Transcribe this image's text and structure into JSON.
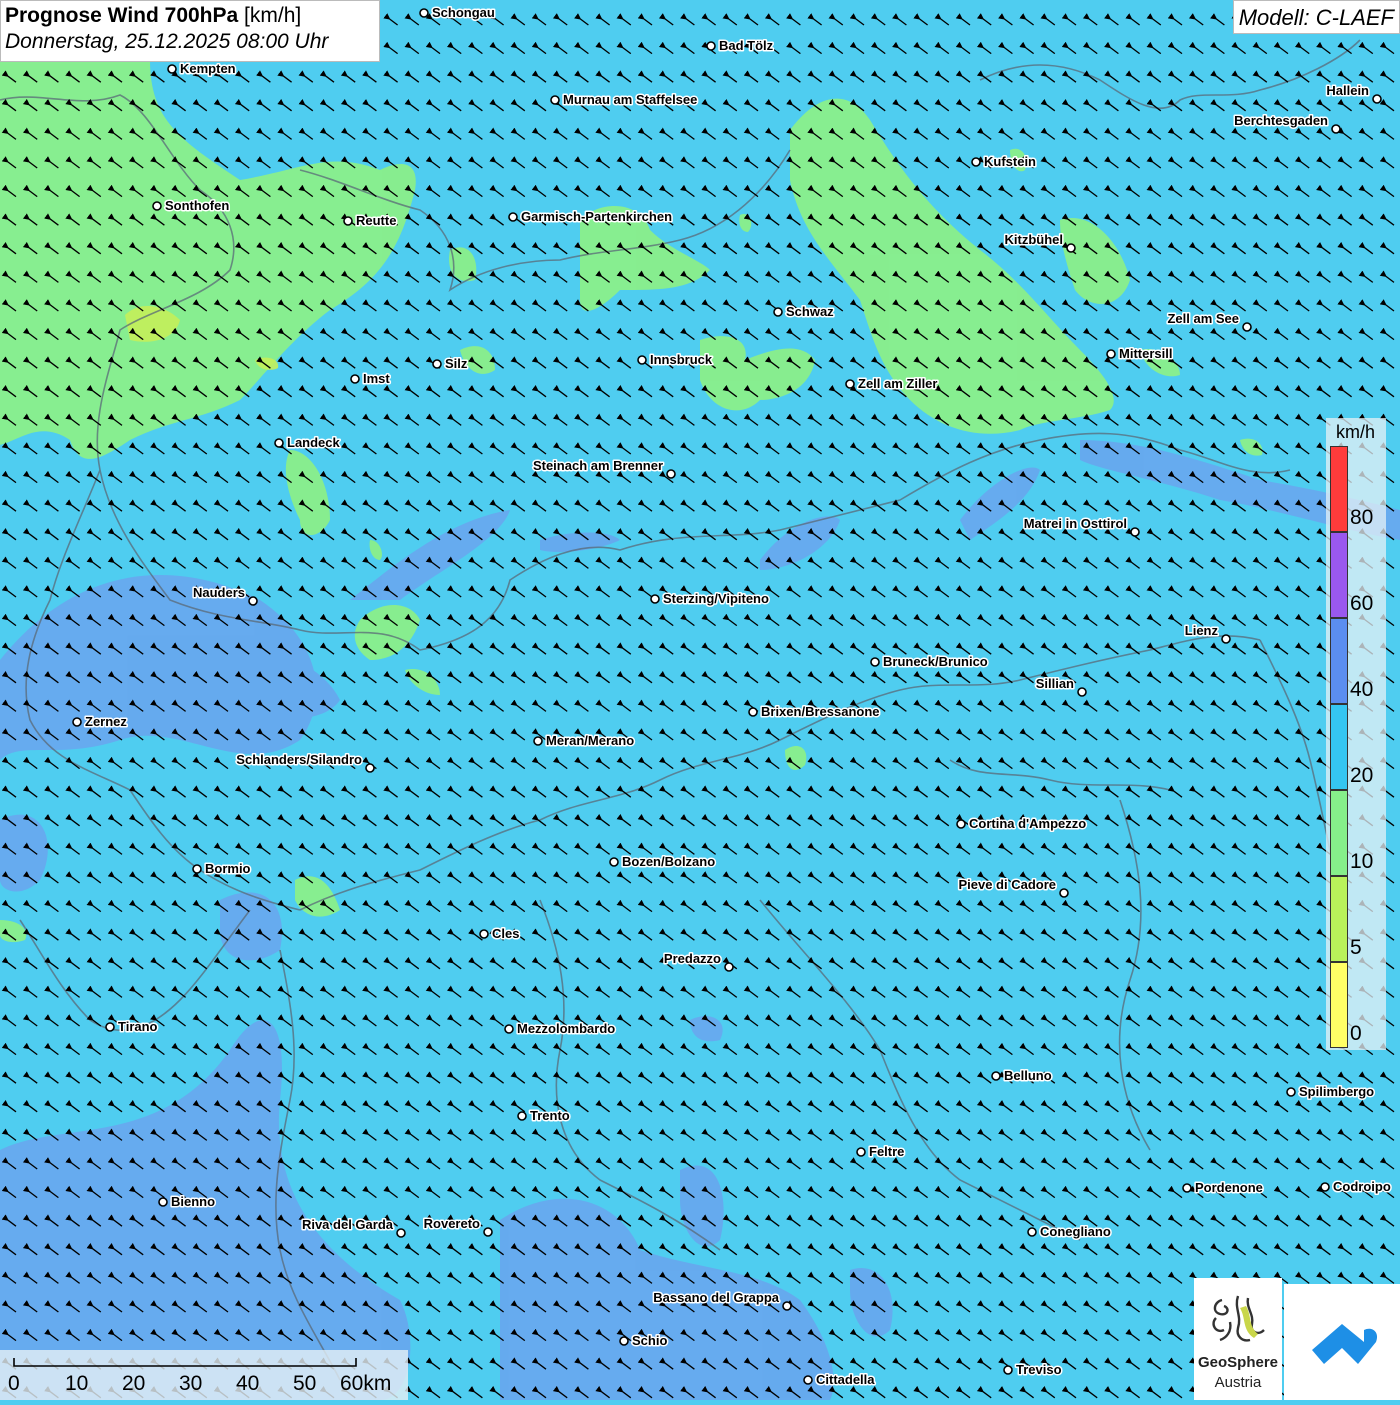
{
  "header": {
    "title_bold": "Prognose Wind 700hPa",
    "title_unit": "[km/h]",
    "datetime": "Donnerstag, 25.12.2025 08:00 Uhr"
  },
  "model": {
    "label": "Modell: C-LAEF"
  },
  "legend": {
    "unit": "km/h",
    "entries": [
      {
        "label": "80",
        "color": "#ff3b3b"
      },
      {
        "label": "60",
        "color": "#9a58ee"
      },
      {
        "label": "40",
        "color": "#5b8ef0"
      },
      {
        "label": "20",
        "color": "#35c6f2"
      },
      {
        "label": "10",
        "color": "#86ef8a"
      },
      {
        "label": "5",
        "color": "#b9f25a"
      },
      {
        "label": "0",
        "color": "#ffff66"
      }
    ],
    "top_color": "#ff3b3b"
  },
  "scale_bar": {
    "labels": [
      "0",
      "10",
      "20",
      "30",
      "40",
      "50",
      "60km"
    ]
  },
  "logos": {
    "geosphere_name": "GeoSphere",
    "geosphere_sub": "Austria"
  },
  "cities": [
    {
      "name": "Schongau"
    },
    {
      "name": "Bad Tölz"
    },
    {
      "name": "Kempten"
    },
    {
      "name": "Murnau am Staffelsee"
    },
    {
      "name": "Hallein"
    },
    {
      "name": "Berchtesgaden"
    },
    {
      "name": "Kufstein"
    },
    {
      "name": "Sonthofen"
    },
    {
      "name": "Reutte"
    },
    {
      "name": "Garmisch-Partenkirchen"
    },
    {
      "name": "Kitzbühel"
    },
    {
      "name": "Schwaz"
    },
    {
      "name": "Zell am See"
    },
    {
      "name": "Mittersill"
    },
    {
      "name": "Silz"
    },
    {
      "name": "Innsbruck"
    },
    {
      "name": "Imst"
    },
    {
      "name": "Zell am Ziller"
    },
    {
      "name": "Landeck"
    },
    {
      "name": "Steinach am Brenner"
    },
    {
      "name": "Matrei in Osttirol"
    },
    {
      "name": "Nauders"
    },
    {
      "name": "Sterzing/Vipiteno"
    },
    {
      "name": "Lienz"
    },
    {
      "name": "Bruneck/Brunico"
    },
    {
      "name": "Sillian"
    },
    {
      "name": "Brixen/Bressanone"
    },
    {
      "name": "Zernez"
    },
    {
      "name": "Meran/Merano"
    },
    {
      "name": "Schlanders/Silandro"
    },
    {
      "name": "Cortina d'Ampezzo"
    },
    {
      "name": "Bozen/Bolzano"
    },
    {
      "name": "Bormio"
    },
    {
      "name": "Pieve di Cadore"
    },
    {
      "name": "Cles"
    },
    {
      "name": "Predazzo"
    },
    {
      "name": "Tirano"
    },
    {
      "name": "Mezzolombardo"
    },
    {
      "name": "Belluno"
    },
    {
      "name": "Spilimbergo"
    },
    {
      "name": "Trento"
    },
    {
      "name": "Feltre"
    },
    {
      "name": "Bienno"
    },
    {
      "name": "Pordenone"
    },
    {
      "name": "Codroipo"
    },
    {
      "name": "Riva del Garda"
    },
    {
      "name": "Rovereto"
    },
    {
      "name": "Conegliano"
    },
    {
      "name": "Bassano del Grappa"
    },
    {
      "name": "Schio"
    },
    {
      "name": "Treviso"
    },
    {
      "name": "Cittadella"
    }
  ]
}
